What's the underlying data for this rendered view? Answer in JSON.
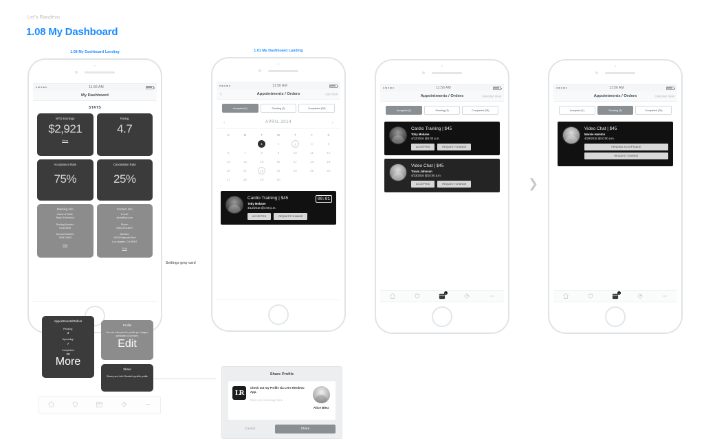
{
  "brand": "Let's Randevu",
  "page_title": "1.08 My Dashboard",
  "accent_color": "#1a8cff",
  "annotation": "Settings gray card",
  "status_bar": {
    "time": "11:56 AM"
  },
  "tab_bar": {
    "items": [
      {
        "name": "home-icon",
        "badge": ""
      },
      {
        "name": "heart-icon",
        "badge": ""
      },
      {
        "name": "calendar-icon",
        "badge": "3"
      },
      {
        "name": "tag-icon",
        "badge": ""
      },
      {
        "name": "menu-icon",
        "badge": ""
      }
    ]
  },
  "screens": [
    {
      "label": "1.08 My Dashboard Landing",
      "nav_title": "My Dashboard",
      "stats_header": "STATS",
      "cards": {
        "mtd_earnings": {
          "title": "MTD Earnings",
          "value": "$2,921",
          "more": "More"
        },
        "rating": {
          "title": "Rating",
          "value": "4.7"
        },
        "acceptance_rate": {
          "title": "Acceptance Rate",
          "value": "75%"
        },
        "cancelation_rate": {
          "title": "Cancelation Rate",
          "value": "25%"
        },
        "banking_info": {
          "title": "Banking Info",
          "bank_label": "Name of Bank:",
          "bank_value": "Bank Of America",
          "routing_label": "Routing Number:",
          "routing_value": "011103093",
          "account_label": "Account Number:",
          "account_value": "74667-6903",
          "edit": "Edit"
        },
        "contact_info": {
          "title": "Contact Info",
          "email_label": "E-mail:",
          "email_value": "alice@liva.com",
          "phone_label": "Phone:",
          "phone_value": "(952) 678-4697",
          "address_label": "Address:",
          "address_line1": "135 N Magnolia Blvd",
          "address_line2": "Los Angeles, CA 90007",
          "edit": "Edit"
        },
        "appointments": {
          "title": "Appointments/Orders",
          "pending_label": "Pending:",
          "pending_value": "3",
          "upcoming_label": "Upcoming:",
          "upcoming_value": "7",
          "completed_label": "Completed:",
          "completed_value": "28",
          "more": "More"
        },
        "profile": {
          "title": "Profile",
          "desc": "You can edit your bio, profile pic, images, specialties & services.",
          "edit": "Edit"
        },
        "share": {
          "title": "Share",
          "desc": "Share your Let's RandeVu profile profile"
        }
      }
    },
    {
      "label": "1.01 My Dashboard Landing",
      "nav_title": "Appointments / Orders",
      "nav_right": "List View",
      "tabs": [
        {
          "label": "Accepted (1)",
          "active": true
        },
        {
          "label": "Pending (3)",
          "active": false
        },
        {
          "label": "Completed (28)",
          "active": false
        }
      ],
      "calendar": {
        "month": "APRIL 2014",
        "dow": [
          "S",
          "M",
          "T",
          "W",
          "T",
          "F",
          "S"
        ],
        "blanks": 2,
        "days": [
          1,
          2,
          3,
          4,
          5,
          6,
          7,
          8,
          9,
          10,
          11,
          12,
          13,
          14,
          15,
          16,
          17,
          18,
          19,
          20,
          21,
          22,
          23,
          24,
          25,
          26,
          27,
          28,
          29,
          30
        ],
        "selected": 1,
        "ringed": [
          3,
          22
        ]
      },
      "appointment": {
        "title": "Cardio Training | $45",
        "name": "Toby Mokane",
        "when": "4/12/2016 @4:00 p.m.",
        "timer": "00:01",
        "buttons": [
          "ACCEPTED",
          "REQUEST CHANGE"
        ]
      }
    },
    {
      "nav_title": "Appointments / Orders",
      "nav_right": "Calendar View",
      "tabs": [
        {
          "label": "Accepted (1)",
          "active": true
        },
        {
          "label": "Pending (3)",
          "active": false
        },
        {
          "label": "Completed (28)",
          "active": false
        }
      ],
      "appointments": [
        {
          "title": "Cardio Training | $45",
          "name": "Toby Mokane",
          "when": "4/12/2016 @4:00 p.m.",
          "buttons": [
            "ACCEPTED",
            "REQUEST CHANGE"
          ]
        },
        {
          "title": "Video Chat | $45",
          "name": "Travis Johnson",
          "when": "4/23/2016 @10:00 a.m.",
          "buttons": [
            "ACCEPTED",
            "REQUEST CHANGE"
          ]
        }
      ]
    },
    {
      "nav_title": "Appointments / Orders",
      "nav_right": "Calendar View",
      "tabs": [
        {
          "label": "Accepted (1)",
          "active": false
        },
        {
          "label": "Pending (3)",
          "active": true
        },
        {
          "label": "Completed (28)",
          "active": false
        }
      ],
      "appointments": [
        {
          "title": "Video Chat | $45",
          "name": "Marnie Hamton",
          "when": "4/29/2016 @10:00 a.m.",
          "buttons": [
            "PENDING ACCEPTANCE",
            "REQUEST CHANGE"
          ]
        }
      ]
    }
  ],
  "share_modal": {
    "title": "Share Profile",
    "logo": "LR",
    "message": "Check out my Profile via Let's RendeVu App.",
    "placeholder": "Enter your message here",
    "person": "Alice Bleu",
    "cancel": "Cancel",
    "share": "Share"
  }
}
